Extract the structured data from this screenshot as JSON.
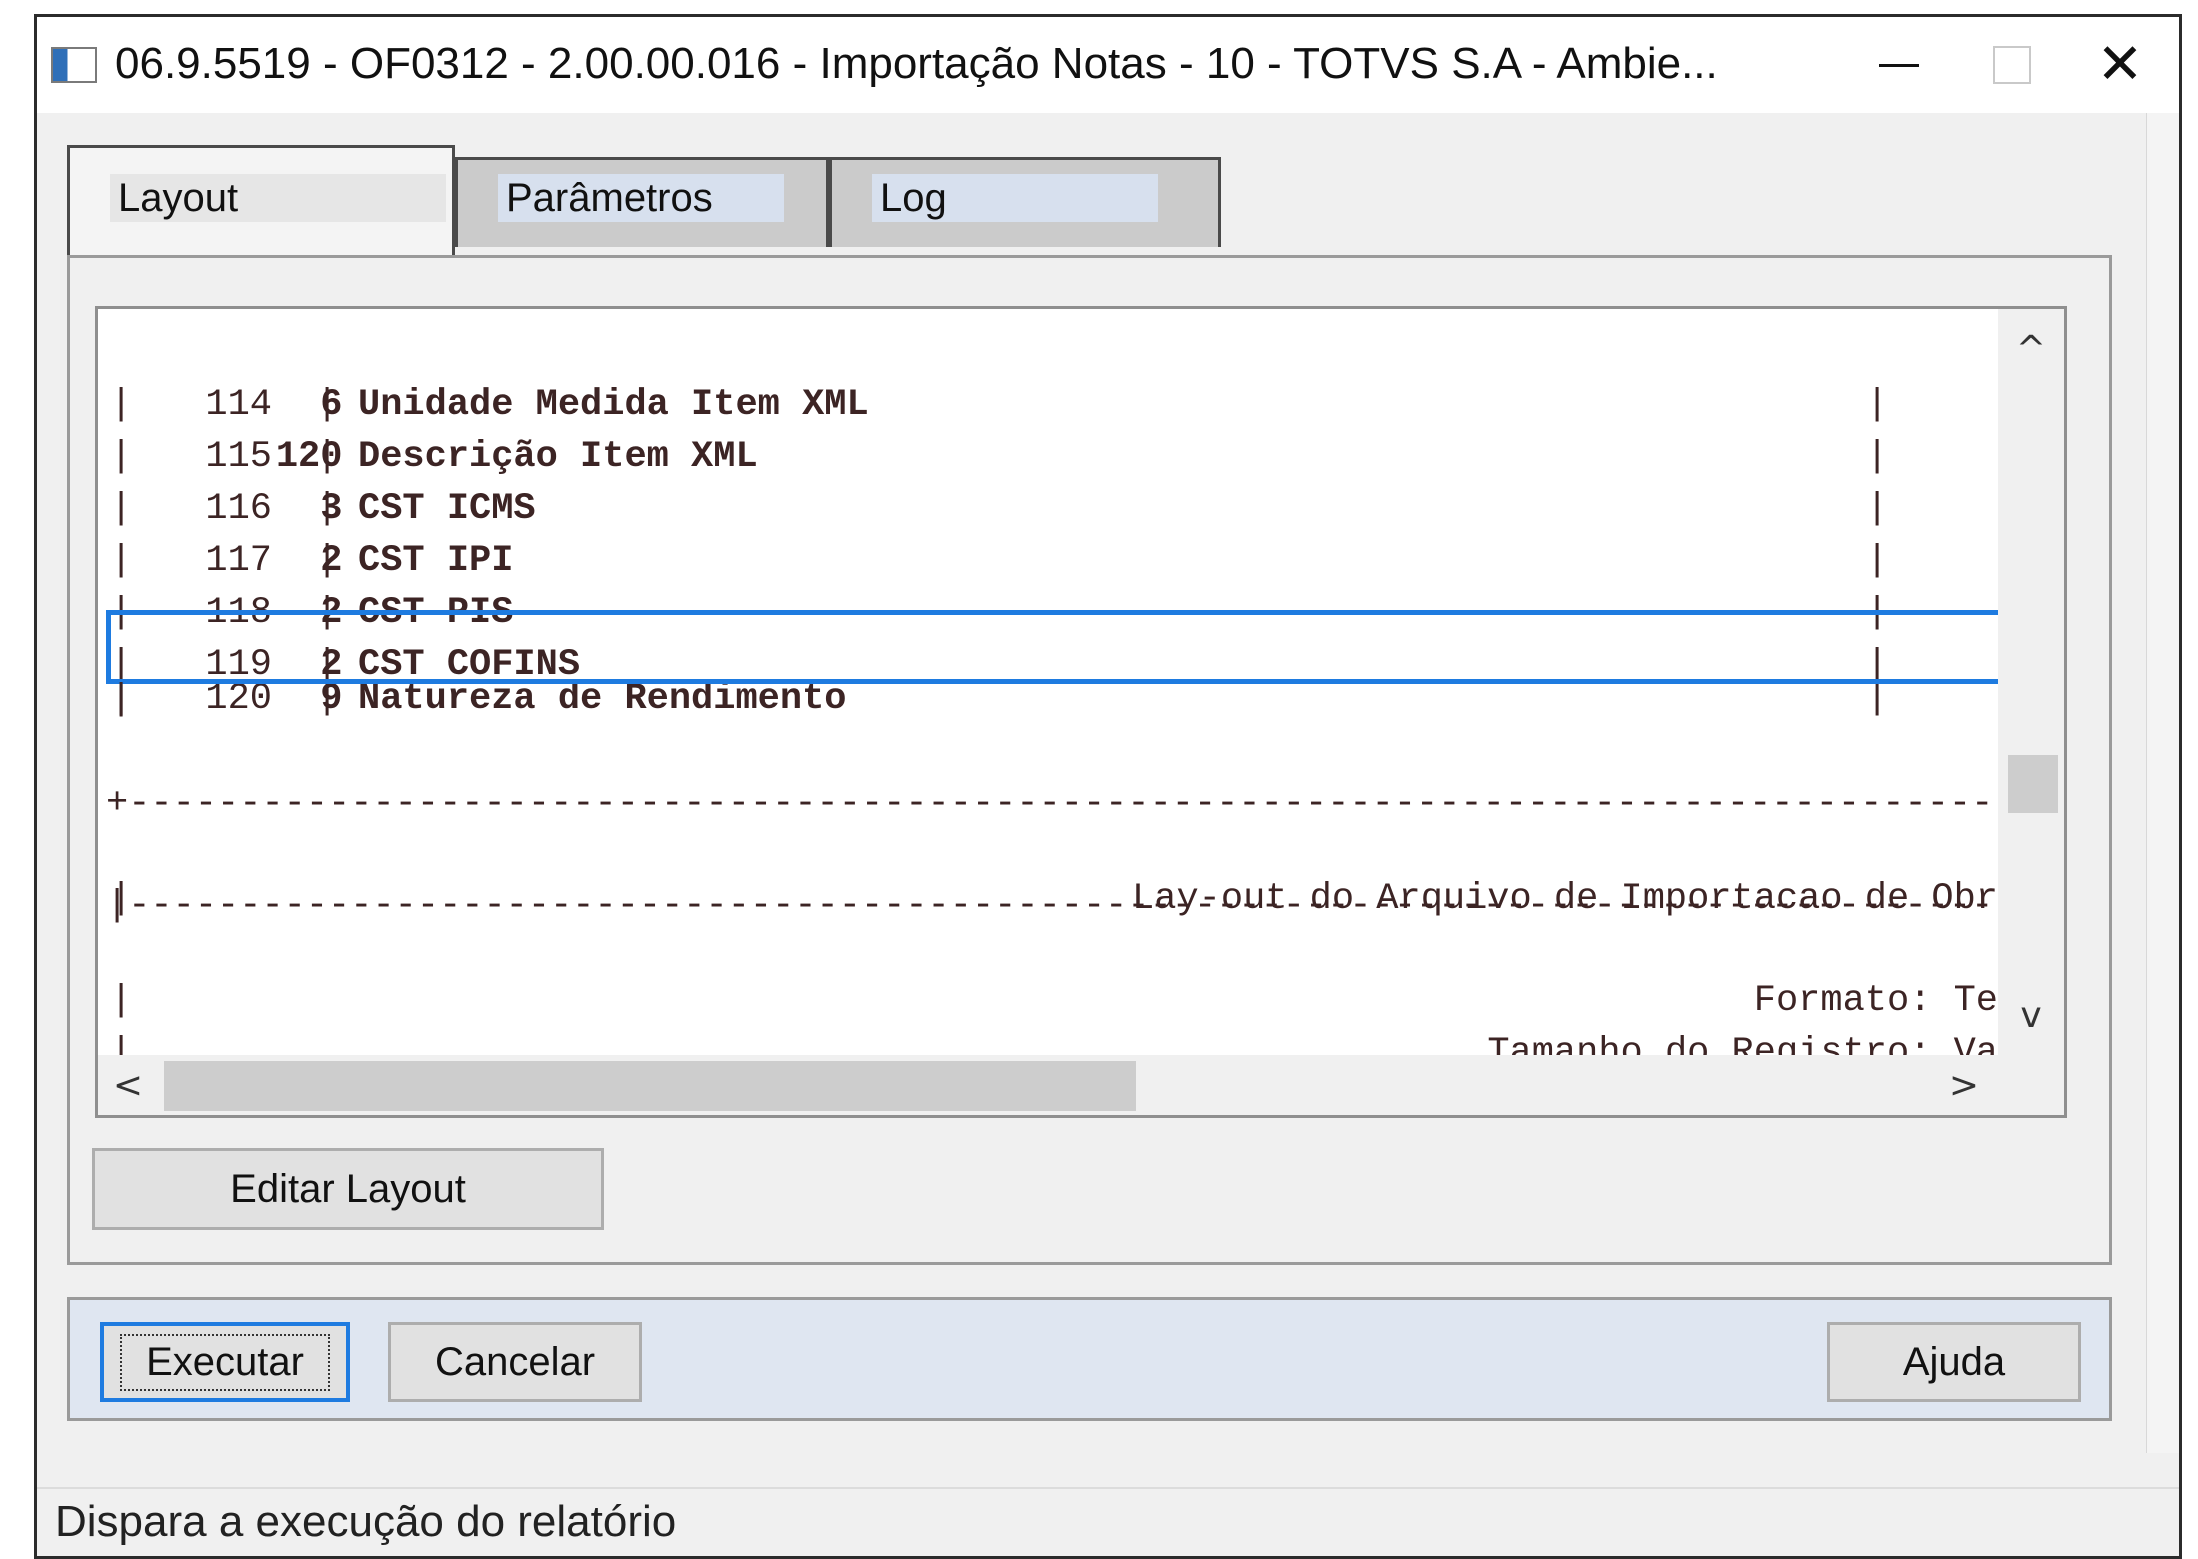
{
  "window": {
    "title": "06.9.5519 - OF0312 - 2.00.00.016 - Importação Notas - 10 - TOTVS S.A - Ambie...",
    "close_glyph": "✕"
  },
  "tabs": [
    {
      "label": "Layout",
      "active": true
    },
    {
      "label": "Parâmetros",
      "active": false
    },
    {
      "label": "Log",
      "active": false
    }
  ],
  "layout_listing": {
    "rows": [
      {
        "num": "114",
        "desc": "Unidade Medida Item XML",
        "size": "6"
      },
      {
        "num": "115",
        "desc": "Descrição Item XML",
        "size": "120"
      },
      {
        "num": "116",
        "desc": "CST ICMS",
        "size": "3"
      },
      {
        "num": "117",
        "desc": "CST IPI",
        "size": "2"
      },
      {
        "num": "118",
        "desc": "CST PIS",
        "size": "2"
      },
      {
        "num": "119",
        "desc": "CST COFINS",
        "size": "2"
      },
      {
        "num": "120",
        "desc": "Natureza de Rendimento",
        "size": "9"
      }
    ],
    "pipe": "|",
    "corner": "+",
    "dashes": "------------------------------------------------------------------------------------------------------------------",
    "header_text": "Lay-out do Arquivo de Importacao de Obr",
    "format_text": "Formato: Te",
    "record_size_text": "Tamanho do Registro: Va"
  },
  "scroll_glyphs": {
    "up": "^",
    "down": "v",
    "left": "<",
    "right": ">"
  },
  "buttons": {
    "edit_layout": "Editar Layout",
    "execute": "Executar",
    "cancel": "Cancelar",
    "help": "Ajuda"
  },
  "status_bar": {
    "text": "Dispara a execução do relatório"
  },
  "colors": {
    "highlight": "#1e7be0",
    "mono_text": "#3c2424"
  }
}
